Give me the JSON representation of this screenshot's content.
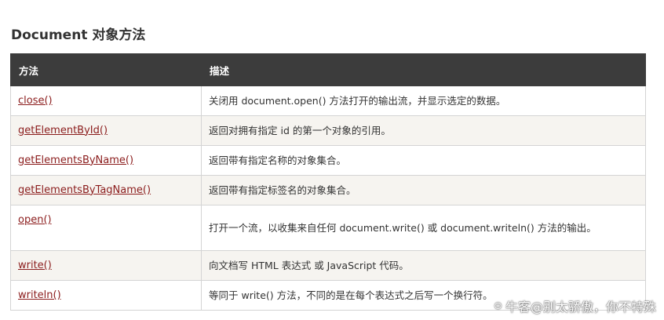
{
  "heading": "Document 对象方法",
  "table": {
    "col_method": "方法",
    "col_desc": "描述",
    "rows": [
      {
        "method": "close()",
        "desc": "关闭用 document.open() 方法打开的输出流，并显示选定的数据。"
      },
      {
        "method": "getElementById()",
        "desc": "返回对拥有指定 id 的第一个对象的引用。"
      },
      {
        "method": "getElementsByName()",
        "desc": "返回带有指定名称的对象集合。"
      },
      {
        "method": "getElementsByTagName()",
        "desc": "返回带有指定标签名的对象集合。"
      },
      {
        "method": "open()",
        "desc": "打开一个流，以收集来自任何 document.write() 或 document.writeln() 方法的输出。"
      },
      {
        "method": "write()",
        "desc": "向文档写 HTML 表达式 或 JavaScript 代码。"
      },
      {
        "method": "writeln()",
        "desc": "等同于 write() 方法，不同的是在每个表达式之后写一个换行符。"
      }
    ]
  },
  "watermark": {
    "icon": "zhihu-logo-icon",
    "text": "牛客@别太骄傲，你不特殊"
  }
}
